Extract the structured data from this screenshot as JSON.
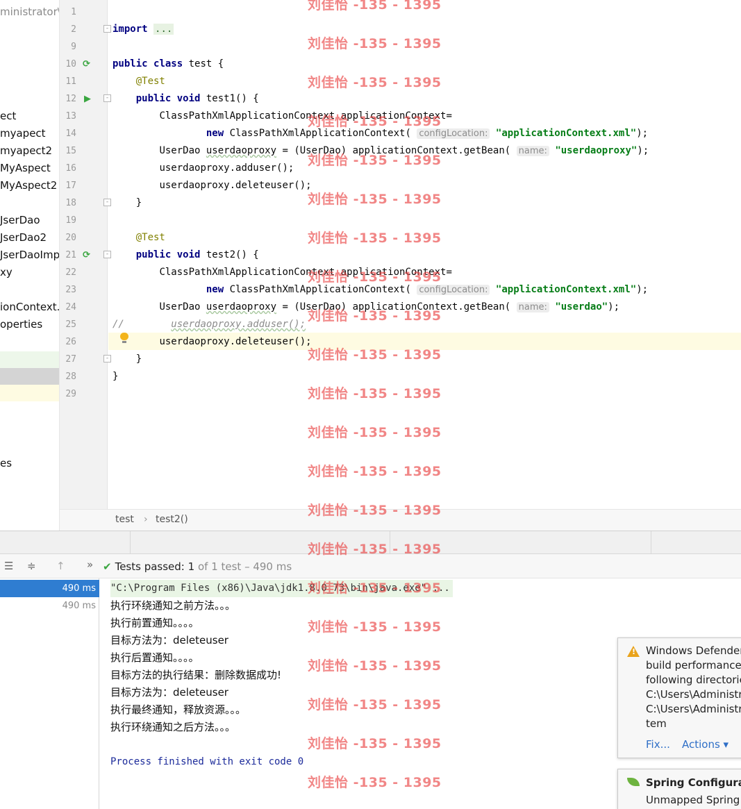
{
  "sidebar": {
    "items": [
      {
        "label": "ministrator\\",
        "dim": true
      },
      {
        "label": "ect"
      },
      {
        "label": "myapect"
      },
      {
        "label": "myapect2"
      },
      {
        "label": "MyAspect"
      },
      {
        "label": "MyAspect2"
      },
      {
        "label": "JserDao"
      },
      {
        "label": "JserDao2"
      },
      {
        "label": "JserDaoImp"
      },
      {
        "label": "xy"
      },
      {
        "label": "ionContext."
      },
      {
        "label": "operties"
      },
      {
        "label": "es"
      }
    ]
  },
  "editor": {
    "line_numbers": [
      "1",
      "2",
      "9",
      "10",
      "11",
      "12",
      "13",
      "14",
      "15",
      "16",
      "17",
      "18",
      "19",
      "20",
      "21",
      "22",
      "23",
      "24",
      "25",
      "26",
      "27",
      "28",
      "29"
    ],
    "code": {
      "import_kw": "import",
      "import_fold": "...",
      "public_kw": "public",
      "class_kw": "class",
      "class_name": " test {",
      "test_ann": "@Test",
      "void_kw": "void",
      "test1_sig": " test1() {",
      "test2_sig": " test2() {",
      "ctx_decl": "ClassPathXmlApplicationContext applicationContext=",
      "new_kw": "new",
      "ctx_ctor": " ClassPathXmlApplicationContext(",
      "config_hint": "configLocation:",
      "config_value": "\"applicationContext.xml\"",
      "close_paren_semicolon": ");",
      "getbean_left": "UserDao ",
      "proxy_var": "userdaoproxy",
      "getbean_mid": " = (UserDao) applicationContext.getBean(",
      "name_hint": "name:",
      "bean_proxy": "\"userdaoproxy\"",
      "bean_dao": "\"userdao\"",
      "call_adduser": "userdaoproxy.adduser();",
      "call_deleteuser": "userdaoproxy.deleteuser();",
      "comment_marker": "//",
      "commented_call": "userdaoproxy.adduser();",
      "close_brace": "}"
    },
    "breadcrumb": {
      "class": "test",
      "separator": "›",
      "method": "test2()"
    }
  },
  "run": {
    "toolbar_overflow": "»",
    "status_passed": "Tests passed:",
    "status_count": "1",
    "status_detail": "of 1 test – 490 ms",
    "tree": [
      {
        "time": "490 ms",
        "selected": true
      },
      {
        "time": "490 ms",
        "selected": false
      }
    ],
    "console": {
      "command": "\"C:\\Program Files (x86)\\Java\\jdk1.8.0_73\\bin\\java.exe\" ...",
      "lines": [
        "执行环绕通知之前方法。。。",
        "执行前置通知。。。。",
        "目标方法为：deleteuser",
        "执行后置通知。。。。",
        "目标方法的执行结果：删除数据成功!",
        "目标方法为：deleteuser",
        "执行最终通知，释放资源。。。",
        "执行环绕通知之后方法。。。"
      ],
      "exit": "Process finished with exit code 0"
    }
  },
  "notifications": {
    "defender": {
      "lines": [
        "Windows Defender",
        "build performance.",
        "following directorie",
        "C:\\Users\\Administra",
        "C:\\Users\\Administra",
        "tem"
      ],
      "fix": "Fix...",
      "actions": "Actions ▾"
    },
    "spring": {
      "title": "Spring Configurati",
      "body": "Unmapped Spring c"
    }
  },
  "watermark": {
    "text": "刘佳怡 -135 - 1395",
    "count": 21
  },
  "colors": {
    "keyword": "#000080",
    "annotation": "#808000",
    "string": "#067d17",
    "caret_line": "#fefbe2",
    "selection": "#2f7dd1",
    "watermark": "#e83c3c"
  }
}
